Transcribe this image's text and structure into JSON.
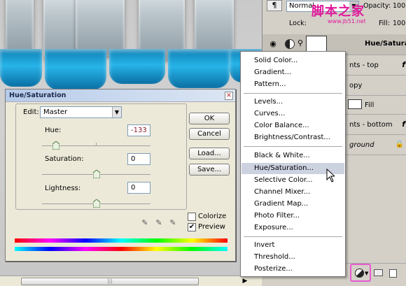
{
  "dialog": {
    "title": "Hue/Saturation",
    "edit_label": "Edit:",
    "edit_value": "Master",
    "hue_label": "Hue:",
    "hue_value": "-133",
    "saturation_label": "Saturation:",
    "saturation_value": "0",
    "lightness_label": "Lightness:",
    "lightness_value": "0",
    "ok_label": "OK",
    "cancel_label": "Cancel",
    "load_label": "Load...",
    "save_label": "Save...",
    "colorize_label": "Colorize",
    "colorize_checked": false,
    "preview_label": "Preview",
    "preview_checked": true,
    "hue_slider_level": 0.13,
    "saturation_slider_level": 0.5,
    "lightness_slider_level": 0.5
  },
  "panel": {
    "blend_mode": "Normal",
    "opacity_label": "Opacity:",
    "opacity_value": "100",
    "lock_label": "Lock:",
    "fill_label": "Fill:",
    "fill_value": "100",
    "layers": [
      {
        "name": "Hue/Saturat",
        "fx": false
      },
      {
        "name": "nts - top",
        "fx": true
      },
      {
        "name": "opy",
        "fx": false
      },
      {
        "name": "Fill",
        "fx": false
      },
      {
        "name": "nts - bottom",
        "fx": true
      },
      {
        "name": "ground",
        "fx": false
      }
    ]
  },
  "menu": {
    "items": [
      "Solid Color...",
      "Gradient...",
      "Pattern...",
      "Levels...",
      "Curves...",
      "Color Balance...",
      "Brightness/Contrast...",
      "Black & White...",
      "Hue/Saturation...",
      "Selective Color...",
      "Channel Mixer...",
      "Gradient Map...",
      "Photo Filter...",
      "Exposure...",
      "Invert",
      "Threshold...",
      "Posterize..."
    ],
    "highlighted": "Hue/Saturation..."
  },
  "watermark": {
    "text": "脚本之家",
    "subtext": "www.jb51.net"
  },
  "colors": {
    "watermark": "#e0189a",
    "menu_highlight": "#cdd2e1",
    "liquid": "#27b4e8"
  }
}
